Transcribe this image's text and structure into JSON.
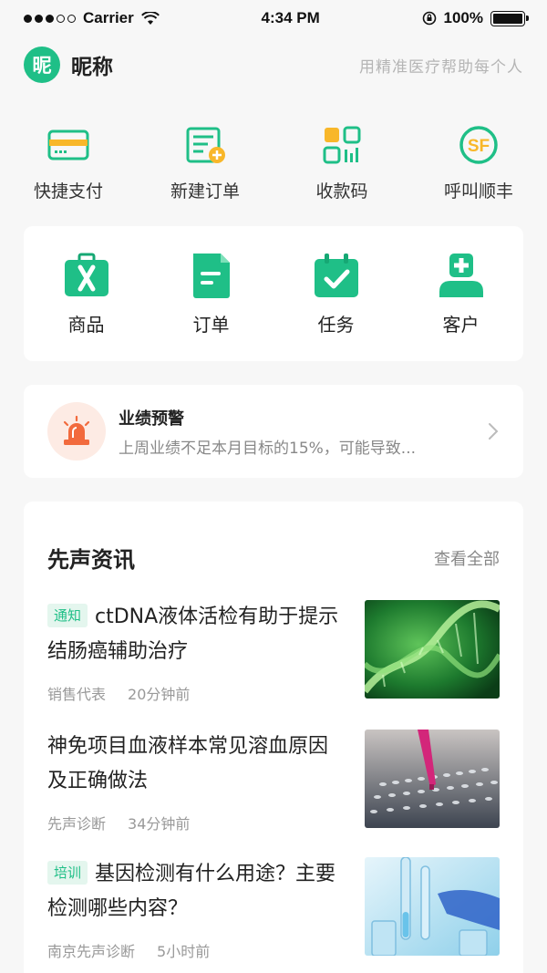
{
  "status_bar": {
    "carrier": "Carrier",
    "time": "4:34 PM",
    "battery": "100%"
  },
  "header": {
    "avatar_text": "昵",
    "nickname": "昵称",
    "slogan": "用精准医疗帮助每个人"
  },
  "quick_actions": [
    {
      "label": "快捷支付",
      "icon": "card-icon"
    },
    {
      "label": "新建订单",
      "icon": "new-order-icon"
    },
    {
      "label": "收款码",
      "icon": "qrcode-icon"
    },
    {
      "label": "呼叫顺丰",
      "icon": "sf-express-icon"
    }
  ],
  "main_menu": [
    {
      "label": "商品",
      "icon": "product-icon"
    },
    {
      "label": "订单",
      "icon": "order-icon"
    },
    {
      "label": "任务",
      "icon": "task-icon"
    },
    {
      "label": "客户",
      "icon": "customer-icon"
    }
  ],
  "alert": {
    "title": "业绩预警",
    "description": "上周业绩不足本月目标的15%，可能导致..."
  },
  "news": {
    "section_title": "先声资讯",
    "view_all": "查看全部",
    "items": [
      {
        "tag": "通知",
        "headline": "ctDNA液体活检有助于提示结肠癌辅助治疗",
        "source": "销售代表",
        "time": "20分钟前",
        "thumb": "dna-image"
      },
      {
        "tag": "",
        "headline": "神免项目血液样本常见溶血原因及正确做法",
        "source": "先声诊断",
        "time": "34分钟前",
        "thumb": "sample-tray-image"
      },
      {
        "tag": "培训",
        "headline": "基因检测有什么用途？主要检测哪些内容？",
        "source": "南京先声诊断",
        "time": "5小时前",
        "thumb": "test-tube-image"
      }
    ]
  },
  "colors": {
    "accent": "#1fbf87",
    "alert": "#f26a3d",
    "icon_yellow": "#f8b72a"
  }
}
